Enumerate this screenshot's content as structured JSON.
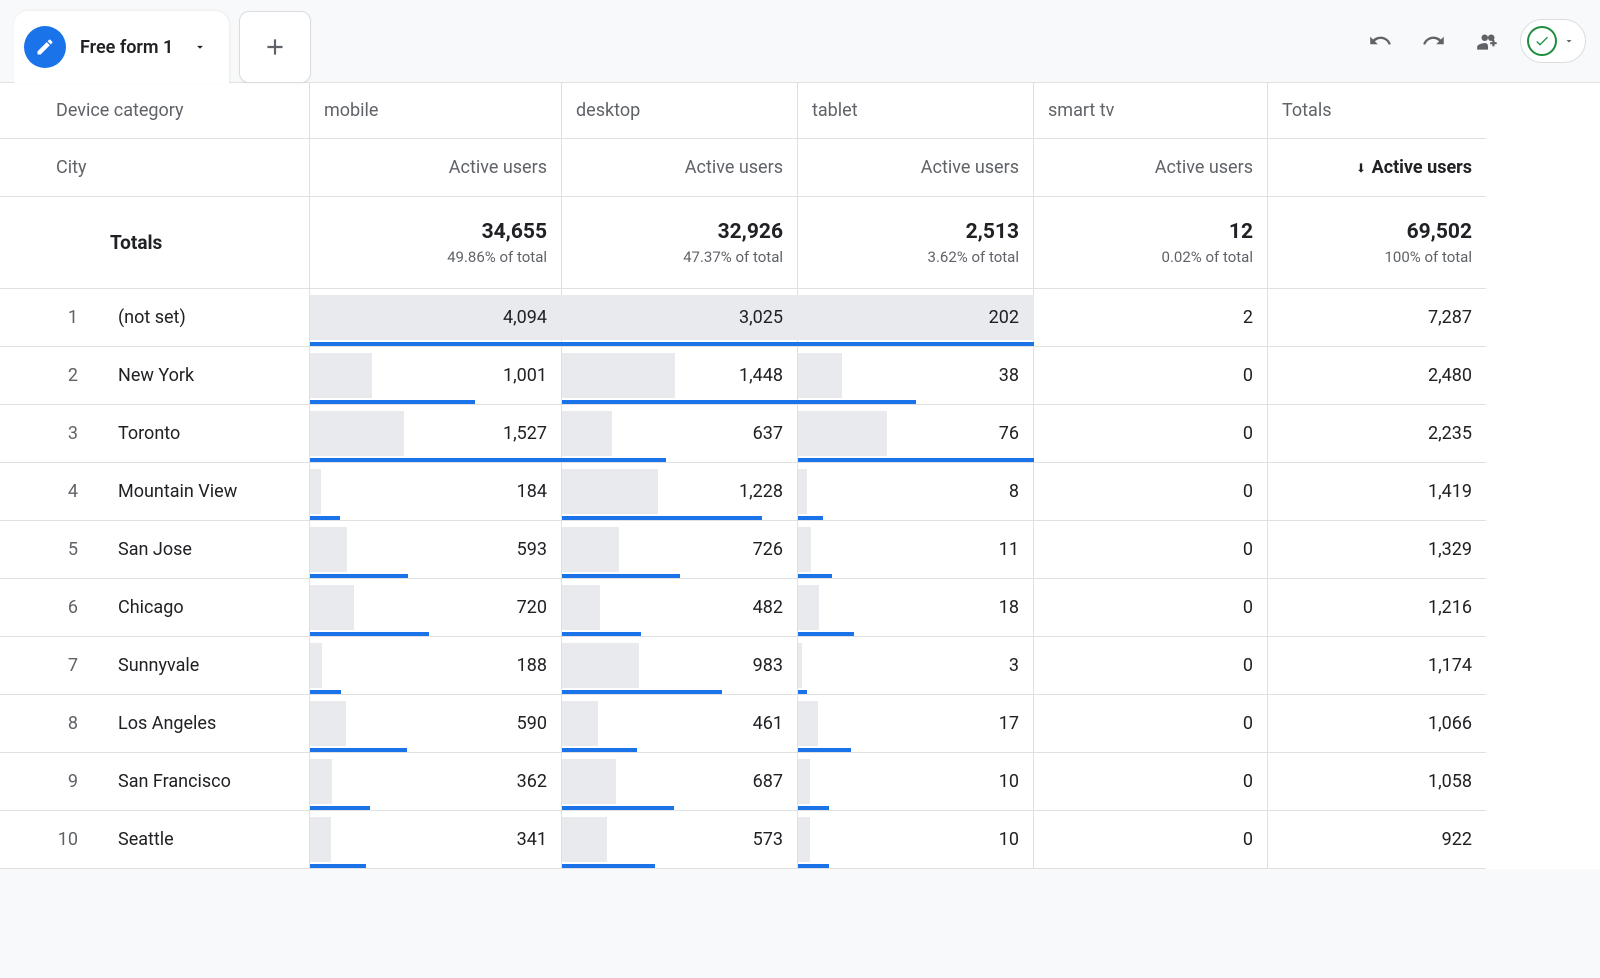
{
  "tab": {
    "title": "Free form 1"
  },
  "table": {
    "dimension_label": "Device category",
    "row_dimension_label": "City",
    "metric_label": "Active users",
    "columns": [
      "mobile",
      "desktop",
      "tablet",
      "smart tv",
      "Totals"
    ],
    "totals_label": "Totals",
    "totals_row": {
      "mobile": {
        "value": "34,655",
        "pct": "49.86% of total"
      },
      "desktop": {
        "value": "32,926",
        "pct": "47.37% of total"
      },
      "tablet": {
        "value": "2,513",
        "pct": "3.62% of total"
      },
      "smarttv": {
        "value": "12",
        "pct": "0.02% of total"
      },
      "total": {
        "value": "69,502",
        "pct": "100% of total"
      }
    },
    "bar_scale": {
      "mobile": {
        "bg_max": 4094,
        "fg_max": 1527
      },
      "desktop": {
        "bg_max": 3025,
        "fg_max": 1448
      },
      "tablet": {
        "bg_max": 202,
        "fg_max": 76
      },
      "smarttv": {
        "bg_max": 2,
        "fg_max": 2
      }
    },
    "rows": [
      {
        "idx": "1",
        "city": "(not set)",
        "mobile": "4,094",
        "mobile_n": 4094,
        "desktop": "3,025",
        "desktop_n": 3025,
        "tablet": "202",
        "tablet_n": 202,
        "smarttv": "2",
        "smarttv_n": 2,
        "total": "7,287"
      },
      {
        "idx": "2",
        "city": "New York",
        "mobile": "1,001",
        "mobile_n": 1001,
        "desktop": "1,448",
        "desktop_n": 1448,
        "tablet": "38",
        "tablet_n": 38,
        "smarttv": "0",
        "smarttv_n": 0,
        "total": "2,480"
      },
      {
        "idx": "3",
        "city": "Toronto",
        "mobile": "1,527",
        "mobile_n": 1527,
        "desktop": "637",
        "desktop_n": 637,
        "tablet": "76",
        "tablet_n": 76,
        "smarttv": "0",
        "smarttv_n": 0,
        "total": "2,235"
      },
      {
        "idx": "4",
        "city": "Mountain View",
        "mobile": "184",
        "mobile_n": 184,
        "desktop": "1,228",
        "desktop_n": 1228,
        "tablet": "8",
        "tablet_n": 8,
        "smarttv": "0",
        "smarttv_n": 0,
        "total": "1,419"
      },
      {
        "idx": "5",
        "city": "San Jose",
        "mobile": "593",
        "mobile_n": 593,
        "desktop": "726",
        "desktop_n": 726,
        "tablet": "11",
        "tablet_n": 11,
        "smarttv": "0",
        "smarttv_n": 0,
        "total": "1,329"
      },
      {
        "idx": "6",
        "city": "Chicago",
        "mobile": "720",
        "mobile_n": 720,
        "desktop": "482",
        "desktop_n": 482,
        "tablet": "18",
        "tablet_n": 18,
        "smarttv": "0",
        "smarttv_n": 0,
        "total": "1,216"
      },
      {
        "idx": "7",
        "city": "Sunnyvale",
        "mobile": "188",
        "mobile_n": 188,
        "desktop": "983",
        "desktop_n": 983,
        "tablet": "3",
        "tablet_n": 3,
        "smarttv": "0",
        "smarttv_n": 0,
        "total": "1,174"
      },
      {
        "idx": "8",
        "city": "Los Angeles",
        "mobile": "590",
        "mobile_n": 590,
        "desktop": "461",
        "desktop_n": 461,
        "tablet": "17",
        "tablet_n": 17,
        "smarttv": "0",
        "smarttv_n": 0,
        "total": "1,066"
      },
      {
        "idx": "9",
        "city": "San Francisco",
        "mobile": "362",
        "mobile_n": 362,
        "desktop": "687",
        "desktop_n": 687,
        "tablet": "10",
        "tablet_n": 10,
        "smarttv": "0",
        "smarttv_n": 0,
        "total": "1,058"
      },
      {
        "idx": "10",
        "city": "Seattle",
        "mobile": "341",
        "mobile_n": 341,
        "desktop": "573",
        "desktop_n": 573,
        "tablet": "10",
        "tablet_n": 10,
        "smarttv": "0",
        "smarttv_n": 0,
        "total": "922"
      }
    ]
  },
  "chart_data": {
    "type": "table",
    "title": "Free form 1",
    "row_dimension": "City",
    "column_dimension": "Device category",
    "metric": "Active users",
    "categories": [
      "mobile",
      "desktop",
      "tablet",
      "smart tv",
      "Totals"
    ],
    "totals": {
      "mobile": 34655,
      "desktop": 32926,
      "tablet": 2513,
      "smart tv": 12,
      "Totals": 69502
    },
    "totals_pct_of_total": {
      "mobile": 49.86,
      "desktop": 47.37,
      "tablet": 3.62,
      "smart tv": 0.02,
      "Totals": 100
    },
    "rows": [
      {
        "city": "(not set)",
        "mobile": 4094,
        "desktop": 3025,
        "tablet": 202,
        "smart tv": 2,
        "Totals": 7287
      },
      {
        "city": "New York",
        "mobile": 1001,
        "desktop": 1448,
        "tablet": 38,
        "smart tv": 0,
        "Totals": 2480
      },
      {
        "city": "Toronto",
        "mobile": 1527,
        "desktop": 637,
        "tablet": 76,
        "smart tv": 0,
        "Totals": 2235
      },
      {
        "city": "Mountain View",
        "mobile": 184,
        "desktop": 1228,
        "tablet": 8,
        "smart tv": 0,
        "Totals": 1419
      },
      {
        "city": "San Jose",
        "mobile": 593,
        "desktop": 726,
        "tablet": 11,
        "smart tv": 0,
        "Totals": 1329
      },
      {
        "city": "Chicago",
        "mobile": 720,
        "desktop": 482,
        "tablet": 18,
        "smart tv": 0,
        "Totals": 1216
      },
      {
        "city": "Sunnyvale",
        "mobile": 188,
        "desktop": 983,
        "tablet": 3,
        "smart tv": 0,
        "Totals": 1174
      },
      {
        "city": "Los Angeles",
        "mobile": 590,
        "desktop": 461,
        "tablet": 17,
        "smart tv": 0,
        "Totals": 1066
      },
      {
        "city": "San Francisco",
        "mobile": 362,
        "desktop": 687,
        "tablet": 10,
        "smart tv": 0,
        "Totals": 1058
      },
      {
        "city": "Seattle",
        "mobile": 341,
        "desktop": 573,
        "tablet": 10,
        "smart tv": 0,
        "Totals": 922
      }
    ],
    "sort": {
      "column": "Totals",
      "direction": "desc"
    }
  }
}
